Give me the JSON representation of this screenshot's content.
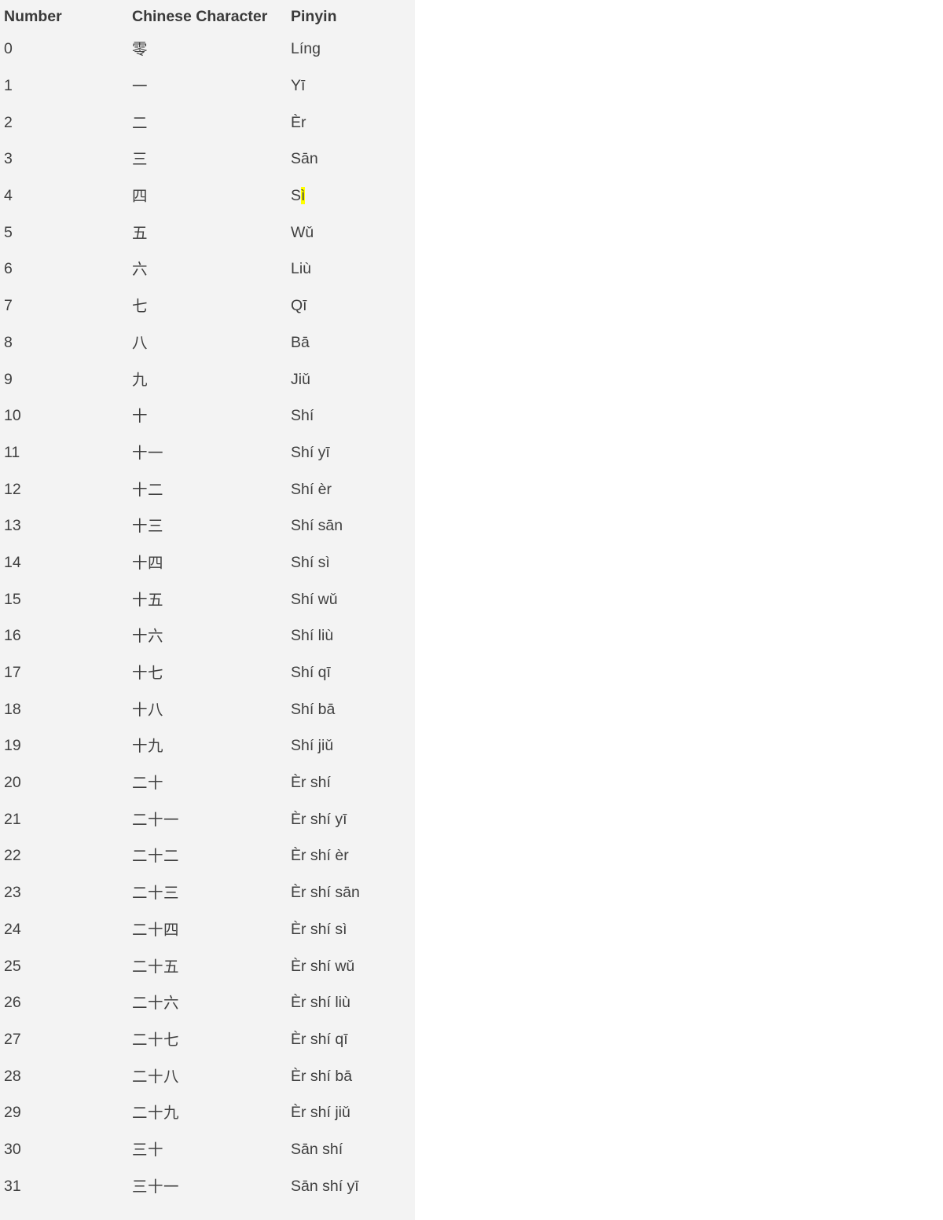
{
  "table": {
    "columns": [
      {
        "key": "number",
        "label": "Number"
      },
      {
        "key": "chinese",
        "label": "Chinese Character"
      },
      {
        "key": "pinyin",
        "label": "Pinyin"
      }
    ],
    "highlight": {
      "row_number": "4",
      "column": "pinyin",
      "text": "ì",
      "color": "#ffff00"
    },
    "rows": [
      {
        "number": "0",
        "chinese": "零",
        "pinyin": "Líng"
      },
      {
        "number": "1",
        "chinese": "一",
        "pinyin": "Yī"
      },
      {
        "number": "2",
        "chinese": "二",
        "pinyin": "Èr"
      },
      {
        "number": "3",
        "chinese": "三",
        "pinyin": "Sān"
      },
      {
        "number": "4",
        "chinese": "四",
        "pinyin": "Sì",
        "pinyin_pre": "S",
        "pinyin_hl": "ì",
        "pinyin_post": ""
      },
      {
        "number": "5",
        "chinese": "五",
        "pinyin": "Wǔ"
      },
      {
        "number": "6",
        "chinese": "六",
        "pinyin": "Liù"
      },
      {
        "number": "7",
        "chinese": "七",
        "pinyin": "Qī"
      },
      {
        "number": "8",
        "chinese": "八",
        "pinyin": "Bā"
      },
      {
        "number": "9",
        "chinese": "九",
        "pinyin": "Jiǔ"
      },
      {
        "number": "10",
        "chinese": "十",
        "pinyin": "Shí"
      },
      {
        "number": "11",
        "chinese": "十一",
        "pinyin": "Shí yī"
      },
      {
        "number": "12",
        "chinese": "十二",
        "pinyin": "Shí èr"
      },
      {
        "number": "13",
        "chinese": "十三",
        "pinyin": "Shí sān"
      },
      {
        "number": "14",
        "chinese": "十四",
        "pinyin": "Shí sì"
      },
      {
        "number": "15",
        "chinese": "十五",
        "pinyin": "Shí wǔ"
      },
      {
        "number": "16",
        "chinese": "十六",
        "pinyin": "Shí liù"
      },
      {
        "number": "17",
        "chinese": "十七",
        "pinyin": "Shí qī"
      },
      {
        "number": "18",
        "chinese": "十八",
        "pinyin": "Shí bā"
      },
      {
        "number": "19",
        "chinese": "十九",
        "pinyin": "Shí jiǔ"
      },
      {
        "number": "20",
        "chinese": "二十",
        "pinyin": "Èr shí"
      },
      {
        "number": "21",
        "chinese": "二十一",
        "pinyin": "Èr shí yī"
      },
      {
        "number": "22",
        "chinese": "二十二",
        "pinyin": "Èr shí èr"
      },
      {
        "number": "23",
        "chinese": "二十三",
        "pinyin": "Èr shí sān"
      },
      {
        "number": "24",
        "chinese": "二十四",
        "pinyin": "Èr shí sì"
      },
      {
        "number": "25",
        "chinese": "二十五",
        "pinyin": "Èr shí wǔ"
      },
      {
        "number": "26",
        "chinese": "二十六",
        "pinyin": "Èr shí liù"
      },
      {
        "number": "27",
        "chinese": "二十七",
        "pinyin": "Èr shí qī"
      },
      {
        "number": "28",
        "chinese": "二十八",
        "pinyin": "Èr shí bā"
      },
      {
        "number": "29",
        "chinese": "二十九",
        "pinyin": "Èr shí jiǔ"
      },
      {
        "number": "30",
        "chinese": "三十",
        "pinyin": "Sān shí"
      },
      {
        "number": "31",
        "chinese": "三十一",
        "pinyin": "Sān shí yī"
      }
    ]
  },
  "colors": {
    "panel_background": "#f3f3f3",
    "page_background": "#ffffff",
    "text": "#3f3f3f",
    "header_text": "#3a3a3a",
    "highlight": "#ffff00"
  }
}
